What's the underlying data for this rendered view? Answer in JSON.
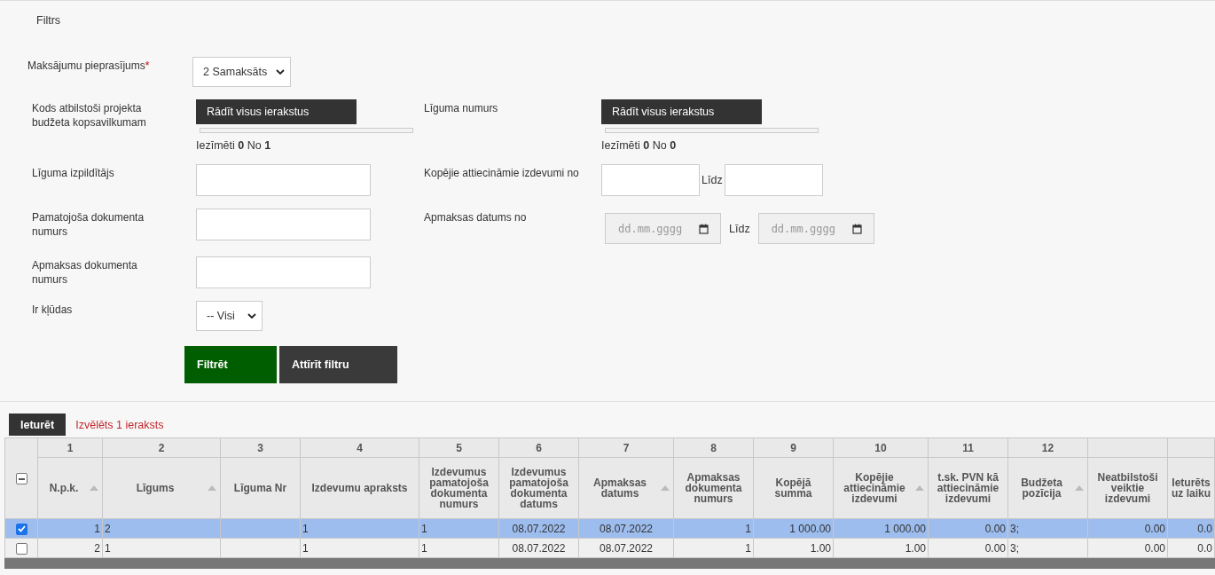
{
  "panel_title": "Filtrs",
  "payment_request": {
    "label": "Maksājumu pieprasījums",
    "required_mark": "*",
    "value": "2 Samaksāts"
  },
  "rows": [
    {
      "left": {
        "kind": "picker",
        "label": "Kods atbilstoši projekta budžeta kopsavilkumam",
        "button": "Rādīt visus ierakstus",
        "count_text": "Iezīmēti **0** No **1**"
      },
      "right": {
        "kind": "picker",
        "label": "Līguma numurs",
        "button": "Rādīt visus ierakstus",
        "count_text": "Iezīmēti **0** No **0**"
      }
    },
    {
      "left": {
        "kind": "text",
        "label": "Līguma izpildītājs"
      },
      "right": {
        "kind": "range",
        "label": "Kopējie attiecināmie izdevumi no",
        "between": "Līdz"
      }
    },
    {
      "left": {
        "kind": "text",
        "label": "Pamatojoša dokumenta numurs"
      },
      "right": {
        "kind": "date_range",
        "label": "Apmaksas datums no",
        "between": "Līdz",
        "from_placeholder": "dd.mm.gggg",
        "to_placeholder": "dd.mm.gggg"
      }
    },
    {
      "left": {
        "kind": "text",
        "label": "Apmaksas dokumenta numurs"
      }
    },
    {
      "left": {
        "kind": "select",
        "label": "Ir kļūdas",
        "value": "-- Visi"
      }
    }
  ],
  "buttons": [
    {
      "kind": "primary",
      "label": "Filtrēt"
    },
    {
      "kind": "secondary",
      "label": "Attīrīt filtru"
    }
  ],
  "action_button": "Ieturēt",
  "selection_text": "Izvēlēts 1 ieraksts",
  "table": {
    "select_all_indeterminate": true,
    "columns": [
      {
        "number": "1",
        "label": "N.p.k.",
        "sortable": true,
        "kind": "number"
      },
      {
        "number": "2",
        "label": "Līgums",
        "sortable": true,
        "kind": "text"
      },
      {
        "number": "3",
        "label": "Līguma Nr",
        "sortable": false,
        "kind": "text"
      },
      {
        "number": "4",
        "label": "Izdevumu apraksts",
        "sortable": false,
        "kind": "text"
      },
      {
        "number": "5",
        "label": "Izdevumus pamatojoša dokumenta numurs",
        "sortable": false,
        "kind": "text"
      },
      {
        "number": "6",
        "label": "Izdevumus pamatojoša dokumenta datums",
        "sortable": false,
        "kind": "date"
      },
      {
        "number": "7",
        "label": "Apmaksas datums",
        "sortable": true,
        "kind": "date"
      },
      {
        "number": "8",
        "label": "Apmaksas dokumenta numurs",
        "sortable": false,
        "kind": "number"
      },
      {
        "number": "9",
        "label": "Kopējā summa",
        "sortable": false,
        "kind": "number"
      },
      {
        "number": "10",
        "label": "Kopējie attiecināmie izdevumi",
        "sortable": true,
        "kind": "number"
      },
      {
        "number": "11",
        "label": "t.sk. PVN kā attiecināmie izdevumi",
        "sortable": false,
        "kind": "number"
      },
      {
        "number": "12",
        "label": "Budžeta pozīcija",
        "sortable": true,
        "kind": "text"
      },
      {
        "label": "Neatbilstoši veiktie izdevumi",
        "sortable": false,
        "kind": "number"
      },
      {
        "label": "Ieturēts uz laiku",
        "sortable": false,
        "kind": "number"
      }
    ],
    "rows": [
      {
        "selected": true,
        "checked": true,
        "cells": [
          "1",
          "2",
          null,
          "1",
          "1",
          "08.07.2022",
          "08.07.2022",
          "1",
          "1 000.00",
          "1 000.00",
          "0.00",
          "3;",
          "0.00",
          "0.0"
        ]
      },
      {
        "selected": false,
        "checked": false,
        "cells": [
          "2",
          "1",
          null,
          "1",
          "1",
          "08.07.2022",
          "08.07.2022",
          "1",
          "1.00",
          "1.00",
          "0.00",
          "3;",
          "0.00",
          "0.0"
        ]
      }
    ]
  }
}
